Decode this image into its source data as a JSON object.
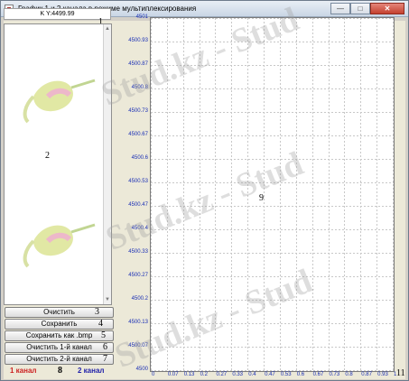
{
  "window": {
    "title": "График 1 и 2 канала в режиме мультиплексирования"
  },
  "titlebar_buttons": {
    "minimize": "—",
    "maximize": "□",
    "close": "✕"
  },
  "header_field": "K Y:4499.99",
  "buttons": {
    "clear": "Очистить",
    "save": "Сохранить",
    "save_bmp": "Сохранить как .bmp",
    "clear_ch1": "Очистить 1-й канал",
    "clear_ch2": "Очистить 2-й канал"
  },
  "channels": {
    "ch1": "1 канал",
    "ch2": "2 канал"
  },
  "annotations": {
    "n1": "1",
    "n2": "2",
    "n3": "3",
    "n4": "4",
    "n5": "5",
    "n6": "6",
    "n7": "7",
    "n8": "8",
    "n9": "9",
    "n10": "10",
    "n11": "11"
  },
  "watermark": "Stud.kz - Stud",
  "chart_data": {
    "type": "line",
    "title": "",
    "xlabel": "",
    "ylabel": "",
    "series": [],
    "x_ticks": [
      "0",
      "0.07",
      "0.13",
      "0.2",
      "0.27",
      "0.33",
      "0.4",
      "0.47",
      "0.53",
      "0.6",
      "0.67",
      "0.73",
      "0.8",
      "0.87",
      "0.93",
      "1"
    ],
    "y_ticks": [
      "4500",
      "4500.07",
      "4500.13",
      "4500.2",
      "4500.27",
      "4500.33",
      "4500.4",
      "4500.47",
      "4500.53",
      "4500.6",
      "4500.67",
      "4500.73",
      "4500.8",
      "4500.87",
      "4500.93",
      "4501"
    ],
    "xlim": [
      0,
      1
    ],
    "ylim": [
      4500,
      4501
    ],
    "grid": true,
    "colors": {
      "axis_labels": "#1a2fb5",
      "grid": "#c8c8c8"
    }
  }
}
